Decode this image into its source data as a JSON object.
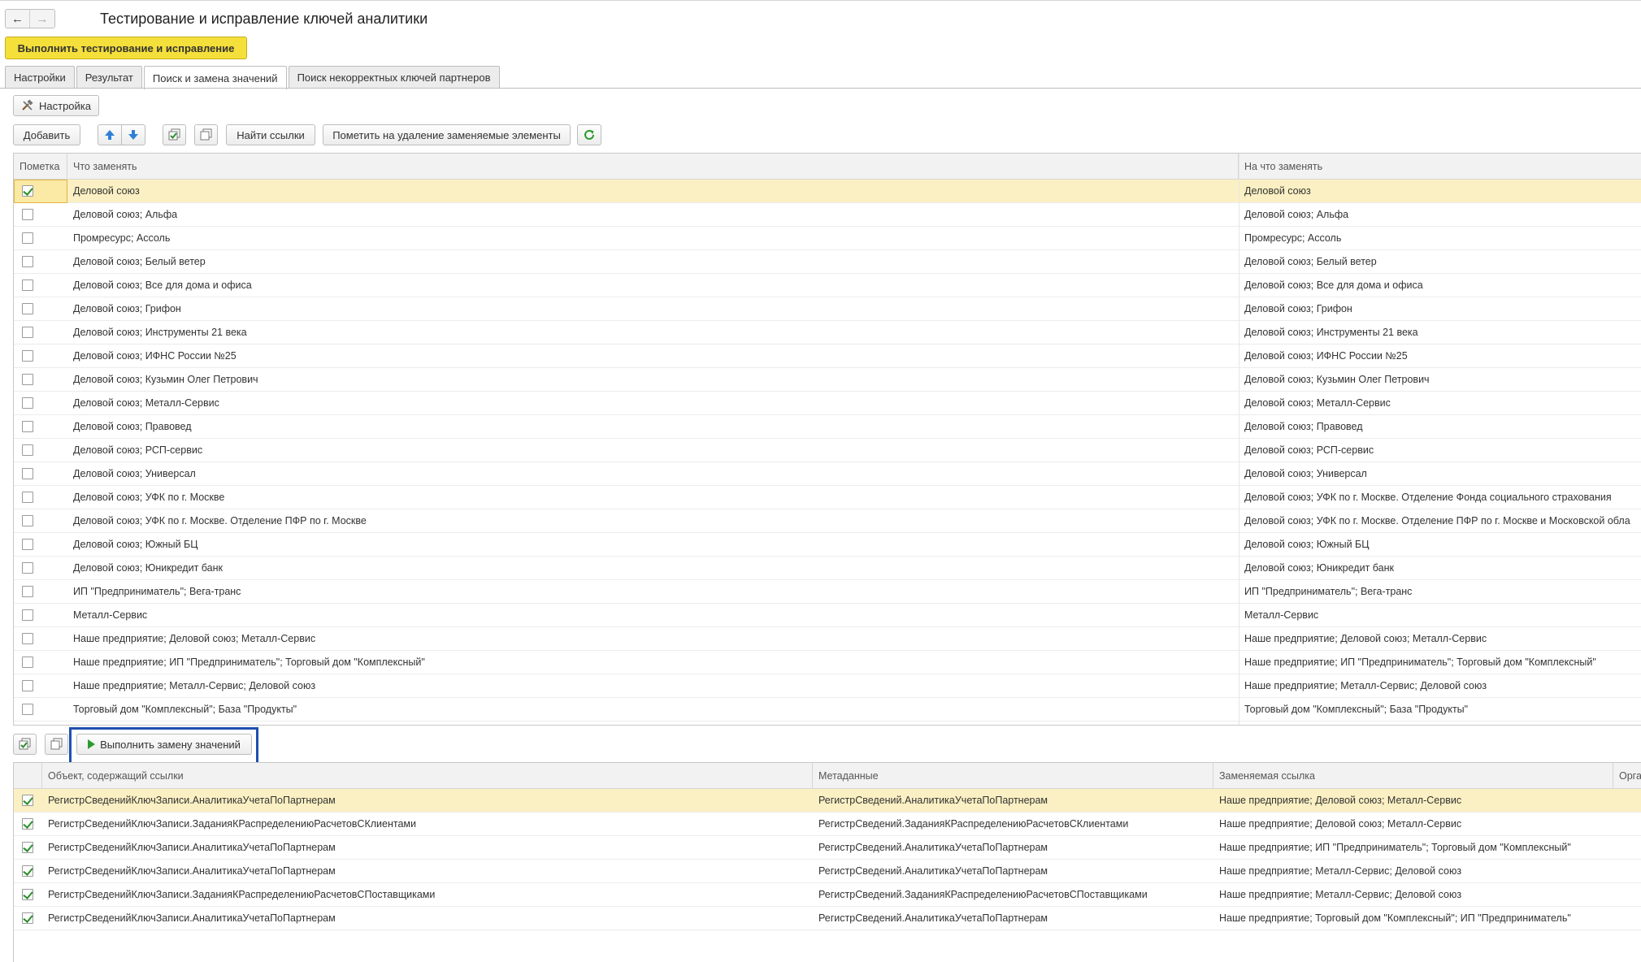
{
  "window": {
    "title": "Тестирование и исправление ключей аналитики"
  },
  "nav": {
    "back": "←",
    "forward": "→"
  },
  "primary_button": "Выполнить тестирование и исправление",
  "tabs": [
    {
      "label": "Настройки",
      "active": false
    },
    {
      "label": "Результат",
      "active": false
    },
    {
      "label": "Поиск и замена значений",
      "active": true
    },
    {
      "label": "Поиск некорректных ключей партнеров",
      "active": false
    }
  ],
  "settings_button": "Настройка",
  "toolbar": {
    "add": "Добавить",
    "find_links": "Найти ссылки",
    "mark_delete": "Пометить на удаление заменяемые элементы"
  },
  "replace_table": {
    "columns": [
      "Пометка",
      "Что заменять",
      "На что заменять"
    ],
    "rows": [
      {
        "checked": true,
        "what": "Деловой союз",
        "to": "Деловой союз"
      },
      {
        "checked": false,
        "what": "Деловой союз; Альфа",
        "to": "Деловой союз; Альфа"
      },
      {
        "checked": false,
        "what": "Промресурс; Ассоль",
        "to": "Промресурс; Ассоль"
      },
      {
        "checked": false,
        "what": "Деловой союз; Белый ветер",
        "to": "Деловой союз; Белый ветер"
      },
      {
        "checked": false,
        "what": "Деловой союз; Все для дома и офиса",
        "to": "Деловой союз; Все для дома и офиса"
      },
      {
        "checked": false,
        "what": "Деловой союз; Грифон",
        "to": "Деловой союз; Грифон"
      },
      {
        "checked": false,
        "what": "Деловой союз; Инструменты 21 века",
        "to": "Деловой союз; Инструменты 21 века"
      },
      {
        "checked": false,
        "what": "Деловой союз; ИФНС России №25",
        "to": "Деловой союз; ИФНС России №25"
      },
      {
        "checked": false,
        "what": "Деловой союз; Кузьмин Олег Петрович",
        "to": "Деловой союз; Кузьмин Олег Петрович"
      },
      {
        "checked": false,
        "what": "Деловой союз; Металл-Сервис",
        "to": "Деловой союз; Металл-Сервис"
      },
      {
        "checked": false,
        "what": "Деловой союз; Правовед",
        "to": "Деловой союз; Правовед"
      },
      {
        "checked": false,
        "what": "Деловой союз; РСП-сервис",
        "to": "Деловой союз; РСП-сервис"
      },
      {
        "checked": false,
        "what": "Деловой союз; Универсал",
        "to": "Деловой союз; Универсал"
      },
      {
        "checked": false,
        "what": "Деловой союз; УФК по г. Москве",
        "to": "Деловой союз; УФК по г. Москве. Отделение Фонда социального страхования"
      },
      {
        "checked": false,
        "what": "Деловой союз; УФК по г. Москве. Отделение ПФР по г. Москве",
        "to": "Деловой союз; УФК по г. Москве. Отделение ПФР по г. Москве и Московской обла"
      },
      {
        "checked": false,
        "what": "Деловой союз; Южный БЦ",
        "to": "Деловой союз; Южный БЦ"
      },
      {
        "checked": false,
        "what": "Деловой союз; Юникредит банк",
        "to": "Деловой союз; Юникредит банк"
      },
      {
        "checked": false,
        "what": "ИП \"Предприниматель\"; Вега-транс",
        "to": "ИП \"Предприниматель\"; Вега-транс"
      },
      {
        "checked": false,
        "what": "Металл-Сервис",
        "to": "Металл-Сервис"
      },
      {
        "checked": false,
        "what": "Наше предприятие; Деловой союз; Металл-Сервис",
        "to": "Наше предприятие; Деловой союз; Металл-Сервис"
      },
      {
        "checked": false,
        "what": "Наше предприятие; ИП \"Предприниматель\"; Торговый дом \"Комплексный\"",
        "to": "Наше предприятие; ИП \"Предприниматель\"; Торговый дом \"Комплексный\""
      },
      {
        "checked": false,
        "what": "Наше предприятие; Металл-Сервис; Деловой союз",
        "to": "Наше предприятие; Металл-Сервис; Деловой союз"
      },
      {
        "checked": false,
        "what": "Торговый дом \"Комплексный\"; База \"Продукты\"",
        "to": "Торговый дом \"Комплексный\"; База \"Продукты\""
      }
    ]
  },
  "execute_button": "Выполнить замену значений",
  "links_table": {
    "columns": [
      "Объект, содержащий ссылки",
      "Метаданные",
      "Заменяемая ссылка",
      "Орга"
    ],
    "rows": [
      {
        "checked": true,
        "object": "РегистрСведенийКлючЗаписи.АналитикаУчетаПоПартнерам",
        "meta": "РегистрСведений.АналитикаУчетаПоПартнерам",
        "link": "Наше предприятие; Деловой союз; Металл-Сервис"
      },
      {
        "checked": true,
        "object": "РегистрСведенийКлючЗаписи.ЗаданияКРаспределениюРасчетовСКлиентами",
        "meta": "РегистрСведений.ЗаданияКРаспределениюРасчетовСКлиентами",
        "link": "Наше предприятие; Деловой союз; Металл-Сервис"
      },
      {
        "checked": true,
        "object": "РегистрСведенийКлючЗаписи.АналитикаУчетаПоПартнерам",
        "meta": "РегистрСведений.АналитикаУчетаПоПартнерам",
        "link": "Наше предприятие; ИП \"Предприниматель\"; Торговый дом \"Комплексный\""
      },
      {
        "checked": true,
        "object": "РегистрСведенийКлючЗаписи.АналитикаУчетаПоПартнерам",
        "meta": "РегистрСведений.АналитикаУчетаПоПартнерам",
        "link": "Наше предприятие; Металл-Сервис; Деловой союз"
      },
      {
        "checked": true,
        "object": "РегистрСведенийКлючЗаписи.ЗаданияКРаспределениюРасчетовСПоставщиками",
        "meta": "РегистрСведений.ЗаданияКРаспределениюРасчетовСПоставщиками",
        "link": "Наше предприятие; Металл-Сервис; Деловой союз"
      },
      {
        "checked": true,
        "object": "РегистрСведенийКлючЗаписи.АналитикаУчетаПоПартнерам",
        "meta": "РегистрСведений.АналитикаУчетаПоПартнерам",
        "link": "Наше предприятие; Торговый дом \"Комплексный\"; ИП \"Предприниматель\""
      }
    ]
  }
}
